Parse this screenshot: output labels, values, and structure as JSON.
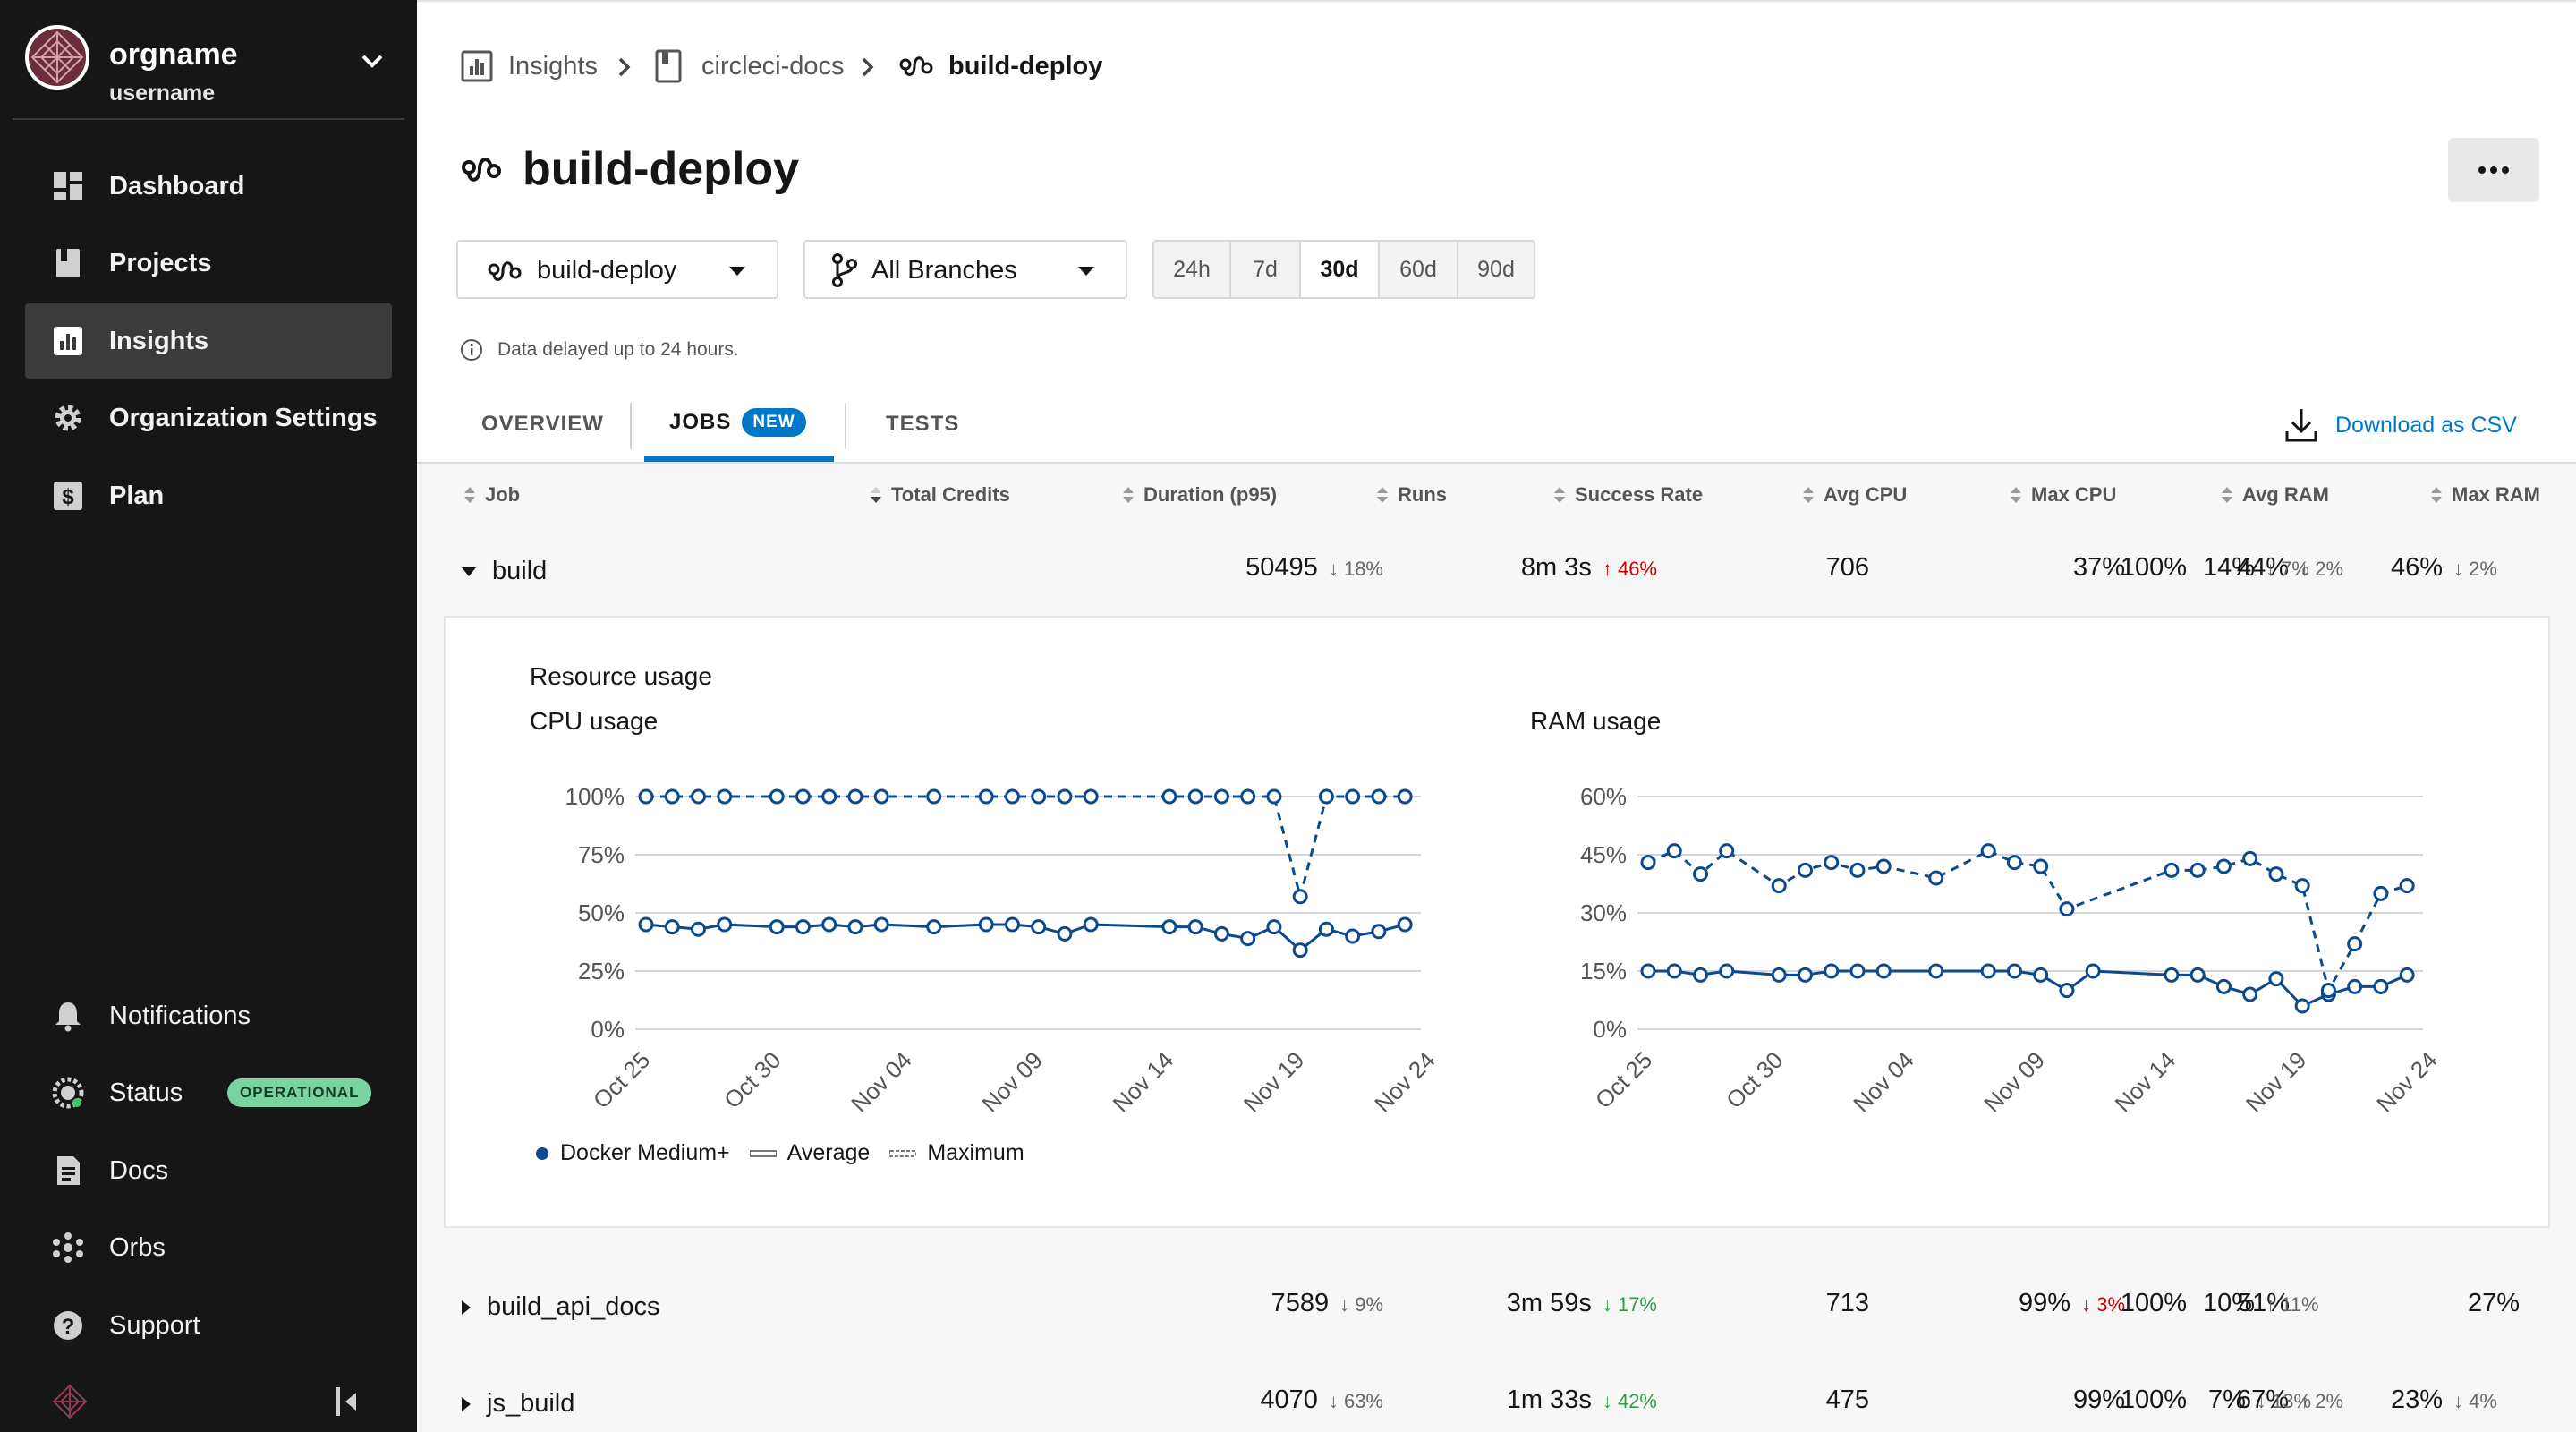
{
  "sidebar": {
    "org_name": "orgname",
    "username": "username",
    "nav": [
      {
        "label": "Dashboard",
        "icon": "dashboard-icon"
      },
      {
        "label": "Projects",
        "icon": "projects-icon"
      },
      {
        "label": "Insights",
        "icon": "insights-icon",
        "active": true
      },
      {
        "label": "Organization Settings",
        "icon": "gear-icon"
      },
      {
        "label": "Plan",
        "icon": "plan-dollar-icon"
      }
    ],
    "bottom_nav": [
      {
        "label": "Notifications",
        "icon": "bell-icon"
      },
      {
        "label": "Status",
        "icon": "status-icon"
      },
      {
        "label": "Docs",
        "icon": "docs-icon"
      },
      {
        "label": "Orbs",
        "icon": "orbs-icon"
      },
      {
        "label": "Support",
        "icon": "help-icon"
      }
    ],
    "status_badge": "OPERATIONAL"
  },
  "breadcrumb": [
    "Insights",
    "circleci-docs",
    "build-deploy"
  ],
  "page_title": "build-deploy",
  "filters": {
    "workflow": "build-deploy",
    "branch": "All Branches",
    "ranges": [
      "24h",
      "7d",
      "30d",
      "60d",
      "90d"
    ],
    "selected_range": "30d"
  },
  "notice": "Data delayed up to 24 hours.",
  "tabs": {
    "overview": "OVERVIEW",
    "jobs": "JOBS",
    "jobs_badge": "NEW",
    "tests": "TESTS"
  },
  "download_csv": "Download as CSV",
  "columns": [
    "Job",
    "Total Credits",
    "Duration (p95)",
    "Runs",
    "Success Rate",
    "Avg CPU",
    "Max CPU",
    "Avg RAM",
    "Max RAM"
  ],
  "rows": [
    {
      "job": "build",
      "credits": "50495",
      "credits_delta": "18%",
      "duration": "8m 3s",
      "duration_delta": "46%",
      "runs": "706",
      "success": "37%",
      "success_delta": "",
      "avg_cpu": "44%",
      "avg_cpu_delta": "2%",
      "max_cpu": "100%",
      "avg_ram": "14%",
      "avg_ram_delta": "7%",
      "max_ram": "46%",
      "max_ram_delta": "2%"
    },
    {
      "job": "build_api_docs",
      "credits": "7589",
      "credits_delta": "9%",
      "duration": "3m 59s",
      "duration_delta": "17%",
      "runs": "713",
      "success": "99%",
      "success_delta": "3%",
      "avg_cpu": "51%",
      "avg_cpu_delta": "",
      "max_cpu": "100%",
      "avg_ram": "10%",
      "avg_ram_delta": "11%",
      "max_ram": "27%",
      "max_ram_delta": ""
    },
    {
      "job": "js_build",
      "credits": "4070",
      "credits_delta": "63%",
      "duration": "1m 33s",
      "duration_delta": "42%",
      "runs": "475",
      "success": "99%",
      "success_delta": "",
      "avg_cpu": "67%",
      "avg_cpu_delta": "2%",
      "max_cpu": "100%",
      "avg_ram": "7%",
      "avg_ram_delta": "13%",
      "max_ram": "23%",
      "max_ram_delta": "4%"
    }
  ],
  "resource_panel": {
    "title": "Resource usage",
    "legend": [
      "Docker Medium+",
      "Average",
      "Maximum"
    ]
  },
  "chart_data": [
    {
      "type": "line",
      "title": "CPU usage",
      "x_ticks": [
        "Oct 25",
        "Oct 30",
        "Nov 04",
        "Nov 09",
        "Nov 14",
        "Nov 19",
        "Nov 24"
      ],
      "y_ticks": [
        "100%",
        "75%",
        "50%",
        "25%",
        "0%"
      ],
      "ylim": [
        0,
        100
      ],
      "x_days": [
        0,
        1,
        2,
        3,
        5,
        6,
        7,
        8,
        9,
        11,
        13,
        14,
        15,
        16,
        17,
        20,
        21,
        22,
        23,
        24,
        25,
        26,
        27,
        28,
        29
      ],
      "series": [
        {
          "name": "Average",
          "style": "solid",
          "values": [
            45,
            44,
            43,
            45,
            44,
            44,
            45,
            44,
            45,
            44,
            45,
            45,
            44,
            41,
            45,
            44,
            44,
            41,
            39,
            44,
            34,
            43,
            40,
            42,
            45
          ]
        },
        {
          "name": "Maximum",
          "style": "dashed",
          "values": [
            100,
            100,
            100,
            100,
            100,
            100,
            100,
            100,
            100,
            100,
            100,
            100,
            100,
            100,
            100,
            100,
            100,
            100,
            100,
            100,
            57,
            100,
            100,
            100,
            100
          ]
        }
      ]
    },
    {
      "type": "line",
      "title": "RAM usage",
      "x_ticks": [
        "Oct 25",
        "Oct 30",
        "Nov 04",
        "Nov 09",
        "Nov 14",
        "Nov 19",
        "Nov 24"
      ],
      "y_ticks": [
        "60%",
        "45%",
        "30%",
        "15%",
        "0%"
      ],
      "ylim": [
        0,
        60
      ],
      "max_x": [
        0,
        1,
        2,
        3,
        5,
        6,
        7,
        8,
        9,
        11,
        13,
        14,
        15,
        16,
        20,
        21,
        22,
        23,
        24,
        25,
        26,
        27,
        28,
        29
      ],
      "max_values": [
        43,
        46,
        40,
        46,
        37,
        41,
        43,
        41,
        42,
        39,
        46,
        43,
        42,
        31,
        41,
        41,
        42,
        44,
        40,
        37,
        10,
        22,
        35,
        37
      ],
      "avg_x": [
        0,
        1,
        2,
        3,
        5,
        6,
        7,
        8,
        9,
        11,
        13,
        14,
        15,
        16,
        17,
        20,
        21,
        22,
        23,
        24,
        25,
        26,
        27,
        28,
        29
      ],
      "avg_values": [
        15,
        15,
        14,
        15,
        14,
        14,
        15,
        15,
        15,
        15,
        15,
        15,
        14,
        10,
        15,
        14,
        14,
        11,
        9,
        13,
        6,
        9,
        11,
        11,
        14
      ]
    }
  ]
}
